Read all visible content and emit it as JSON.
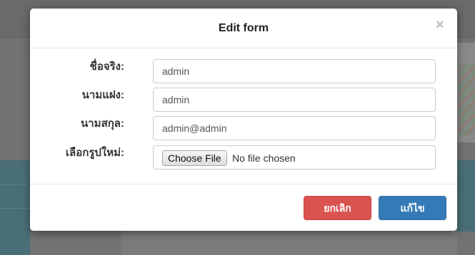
{
  "modal": {
    "title": "Edit form",
    "close_glyph": "×"
  },
  "form": {
    "fields": [
      {
        "label": "ชื่อจริง:",
        "value": "admin"
      },
      {
        "label": "นามแฝง:",
        "value": "admin"
      },
      {
        "label": "นามสกุล:",
        "value": "admin@admin"
      }
    ],
    "file": {
      "label": "เลือกรูปใหม่:",
      "button_label": "Choose File",
      "status": "No file chosen"
    }
  },
  "footer": {
    "cancel_label": "ยกเลิก",
    "submit_label": "แก้ไข"
  },
  "colors": {
    "cancel": "#d9534f",
    "submit": "#337ab7",
    "overlay": "#6f6f6f"
  }
}
